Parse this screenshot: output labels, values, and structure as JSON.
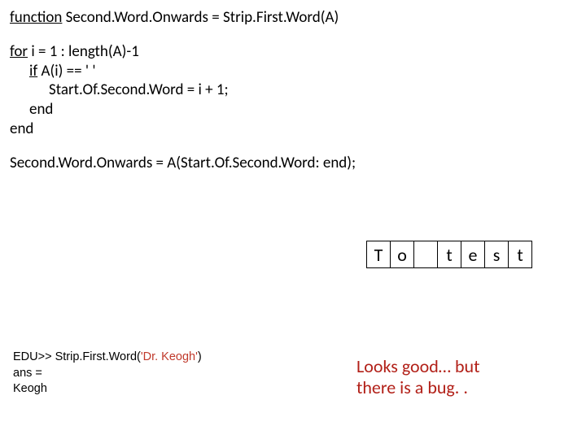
{
  "code": {
    "line1_kw": "function",
    "line1_rest": " Second.Word.Onwards = Strip.First.Word(A)",
    "line2_kw": "for",
    "line2_rest": " i = 1 : length(A)-1",
    "line3_kw": "if",
    "line3_rest": " A(i) == ' '",
    "line4": "Start.Of.Second.Word = i + 1;",
    "line5": "end",
    "line6": "end",
    "line7": "Second.Word.Onwards = A(Start.Of.Second.Word: end);"
  },
  "boxes": {
    "c0": "T",
    "c1": "o",
    "c2": " ",
    "c3": "t",
    "c4": "e",
    "c5": "s",
    "c6": "t"
  },
  "console": {
    "prompt": "EDU>> Strip.First.Word(",
    "arg": "'Dr. Keogh'",
    "close": ")",
    "out1": "ans =",
    "out2": "Keogh"
  },
  "comment": {
    "l1": "Looks good… but",
    "l2": "there is a bug. ."
  }
}
